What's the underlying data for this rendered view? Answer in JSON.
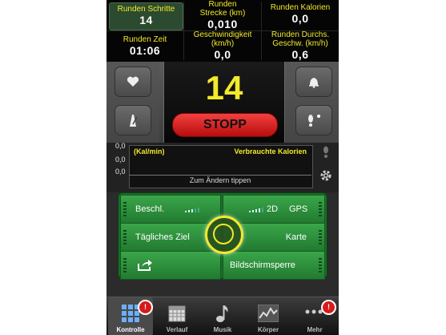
{
  "stats": {
    "steps": {
      "label": "Runden Schritte",
      "value": "14"
    },
    "distance": {
      "label": "Runden Strecke (km)",
      "value": "0,010"
    },
    "calories": {
      "label": "Runden Kalorien",
      "value": "0,0"
    },
    "time": {
      "label": "Runden Zeit",
      "value": "01:06"
    },
    "speed": {
      "label": "Geschwindigkeit (km/h)",
      "value": "0,0"
    },
    "avg_speed": {
      "label": "Runden Durchs. Geschw. (km/h)",
      "value": "0,6"
    }
  },
  "control": {
    "step_count": "14",
    "stop_label": "STOPP"
  },
  "calories_graph": {
    "unit": "(Kal/min)",
    "title": "Verbrauchte Kalorien",
    "ticks": [
      "0,0",
      "0,0",
      "0,0"
    ],
    "hint": "Zum Ändern tippen"
  },
  "grid": {
    "beschl_label": "Beschl.",
    "gps_mode": "2D",
    "gps_label": "GPS",
    "goal_label": "Tägliches Ziel",
    "map_label": "Karte",
    "lock_label": "Bildschirmsperre"
  },
  "tabs": [
    {
      "label": "Kontrolle",
      "icon": "grid-icon",
      "active": true
    },
    {
      "label": "Verlauf",
      "icon": "calendar-icon"
    },
    {
      "label": "Musik",
      "icon": "music-note-icon"
    },
    {
      "label": "Körper",
      "icon": "body-chart-icon"
    },
    {
      "label": "Mehr",
      "icon": "more-dots-icon"
    }
  ],
  "badge_text": "!",
  "colors": {
    "accent_yellow": "#f2ea2a",
    "stop_red": "#d81a1a",
    "grid_green": "#2f9a40",
    "background_dark": "#050505"
  }
}
